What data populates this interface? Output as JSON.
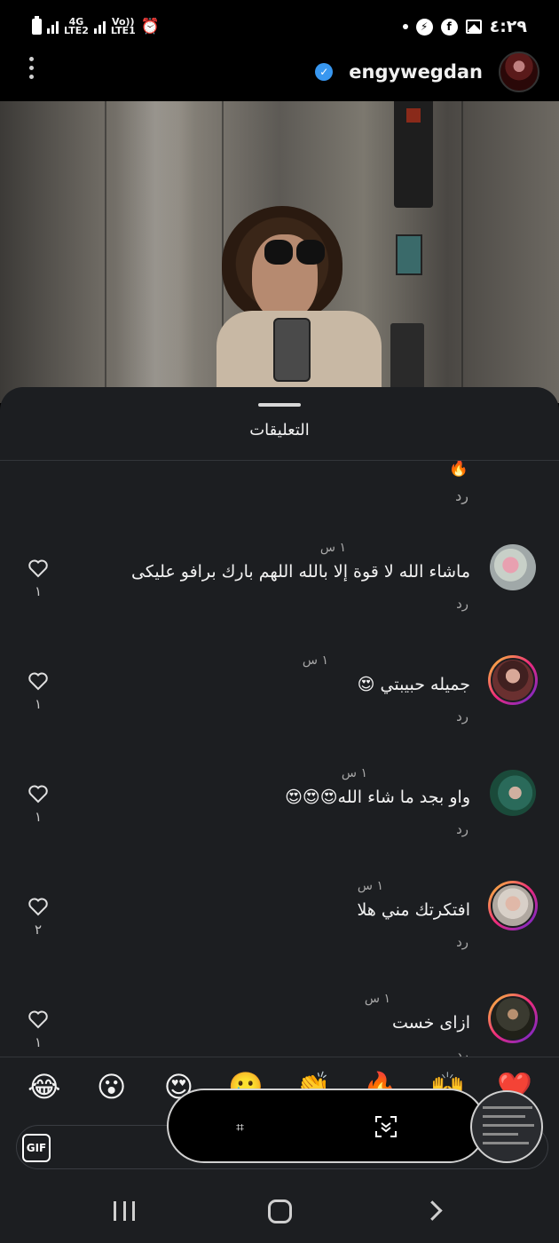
{
  "status_bar": {
    "time": "٤:٢٩",
    "network_1_top": "4G",
    "network_1_bottom": "LTE2",
    "network_2_top": "Vo))",
    "network_2_bottom": "LTE1",
    "network_3_top": "Vo))"
  },
  "header": {
    "username": "engywegdan",
    "verified": true
  },
  "sheet": {
    "title": "التعليقات",
    "partial_emoji": "🔥",
    "partial_reply": "رد"
  },
  "comments": [
    {
      "time": "١ س",
      "text": "ماشاء الله لا قوة إلا بالله اللهم بارك برافو عليكى",
      "reply": "رد",
      "likes": "١",
      "avatar_ring": false
    },
    {
      "time": "١ س",
      "text": "جميله حبيبتي 😍",
      "reply": "رد",
      "likes": "١",
      "avatar_ring": true
    },
    {
      "time": "١ س",
      "text": "واو بجد ما شاء الله😍😍😍",
      "reply": "رد",
      "likes": "١",
      "avatar_ring": false
    },
    {
      "time": "١ س",
      "text": "افتكرتك مني هلا",
      "reply": "رد",
      "likes": "٢",
      "avatar_ring": true
    },
    {
      "time": "١ س",
      "text": "ازاى خست",
      "reply": "رد",
      "likes": "١",
      "avatar_ring": true
    }
  ],
  "emoji_bar": [
    "😂",
    "😮",
    "😍",
    "🥲",
    "👏",
    "🔥",
    "🙌",
    "❤️"
  ],
  "input": {
    "gif_label": "GIF"
  }
}
